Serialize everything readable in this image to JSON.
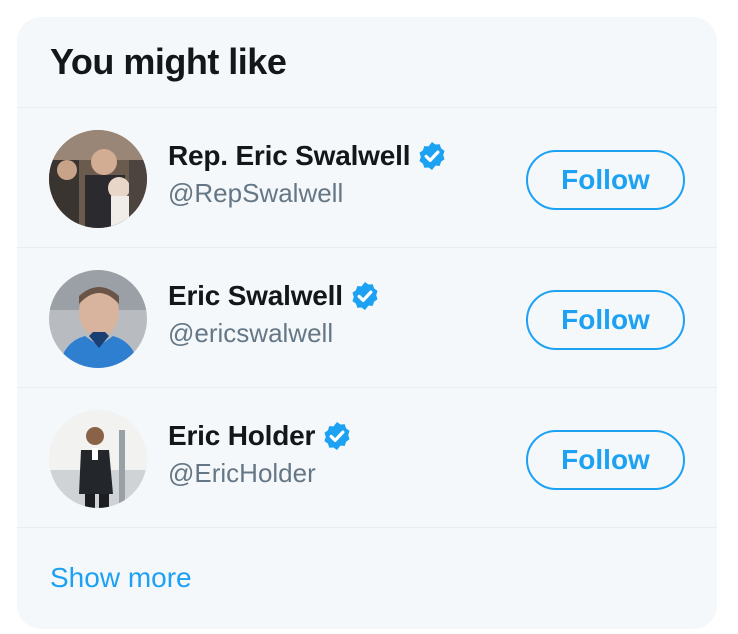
{
  "header": {
    "title": "You might like"
  },
  "suggestions": [
    {
      "name": "Rep. Eric Swalwell",
      "handle": "@RepSwalwell",
      "verified": true,
      "button_label": "Follow"
    },
    {
      "name": "Eric Swalwell",
      "handle": "@ericswalwell",
      "verified": true,
      "button_label": "Follow"
    },
    {
      "name": "Eric Holder",
      "handle": "@EricHolder",
      "verified": true,
      "button_label": "Follow"
    }
  ],
  "footer": {
    "show_more_label": "Show more"
  },
  "colors": {
    "accent": "#1da1f2",
    "card_bg": "#f5f8fa",
    "name": "#14171a",
    "handle": "#657786"
  },
  "icons": {
    "verified": "verified-badge-icon"
  }
}
